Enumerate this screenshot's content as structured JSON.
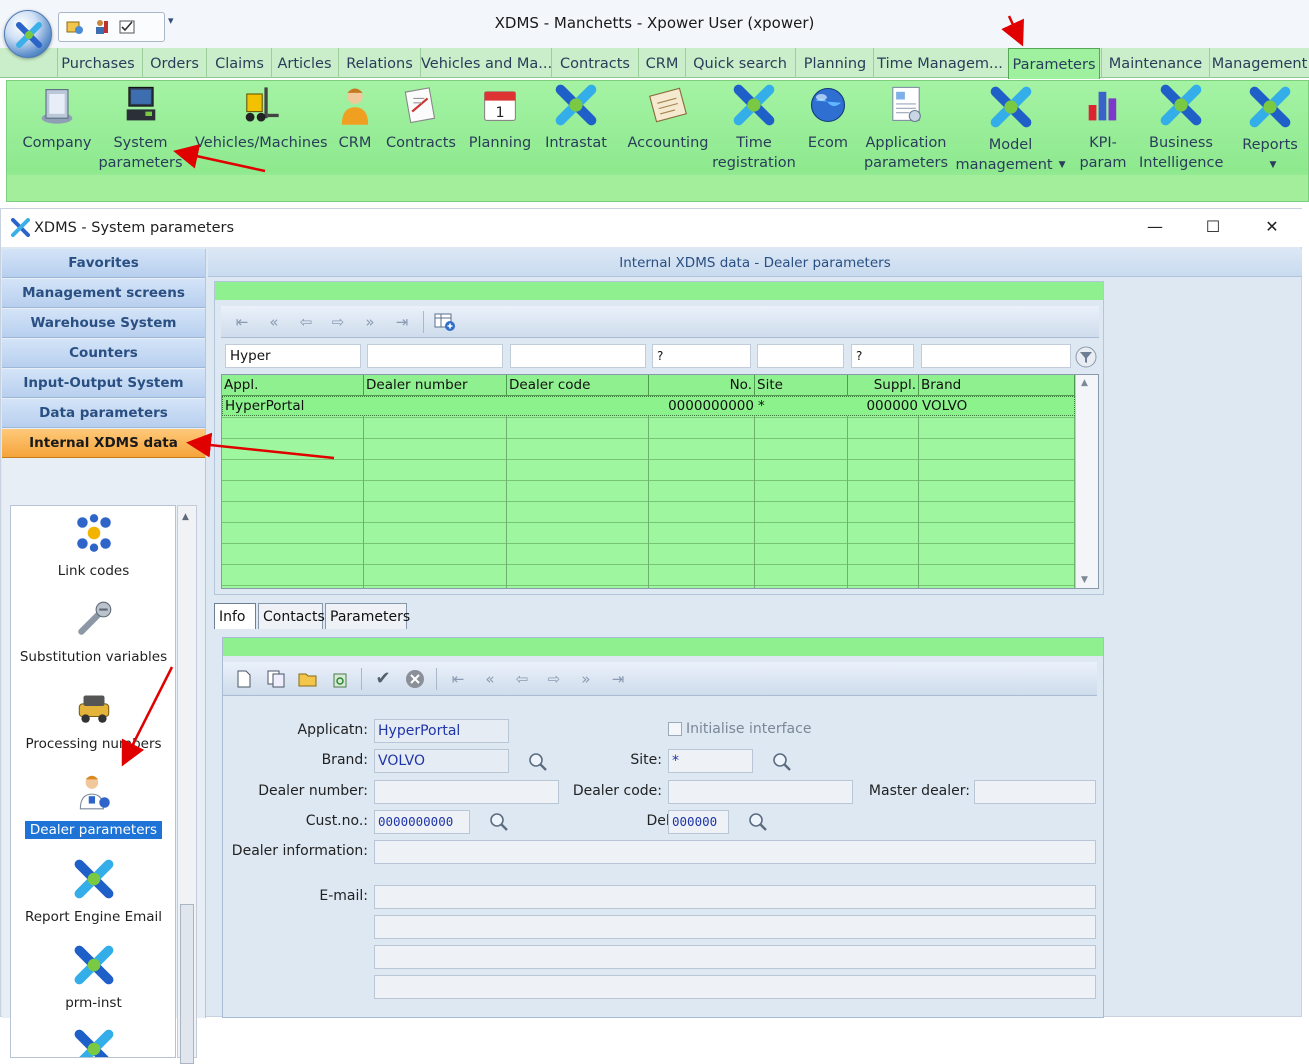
{
  "app": {
    "title": "XDMS - Manchetts - Xpower User (xpower)",
    "qat_more": "▾"
  },
  "ribbon": {
    "tabs": [
      "Purchases",
      "Orders",
      "Claims",
      "Articles",
      "Relations",
      "Vehicles and Ma...",
      "Contracts",
      "CRM",
      "Quick search",
      "Planning",
      "Time Managem...",
      "Parameters",
      "Maintenance",
      "Management"
    ],
    "active_tab": "Parameters",
    "buttons": [
      {
        "line1": "Company",
        "line2": "",
        "icon": "company-icon"
      },
      {
        "line1": "System",
        "line2": "parameters",
        "icon": "computer-icon"
      },
      {
        "line1": "Vehicles/Machines",
        "line2": "",
        "icon": "forklift-icon"
      },
      {
        "line1": "CRM",
        "line2": "",
        "icon": "person-icon"
      },
      {
        "line1": "Contracts",
        "line2": "",
        "icon": "contract-icon"
      },
      {
        "line1": "Planning",
        "line2": "",
        "icon": "calendar-icon"
      },
      {
        "line1": "Intrastat",
        "line2": "",
        "icon": "xdms-icon"
      },
      {
        "line1": "Accounting",
        "line2": "",
        "icon": "ledger-icon"
      },
      {
        "line1": "Time",
        "line2": "registration",
        "icon": "xdms-icon"
      },
      {
        "line1": "Ecom",
        "line2": "",
        "icon": "globe-icon"
      },
      {
        "line1": "Application",
        "line2": "parameters",
        "icon": "app-params-icon"
      },
      {
        "line1": "Model",
        "line2": "management",
        "icon": "xdms-icon",
        "dropdown": true
      },
      {
        "line1": "KPI-",
        "line2": "param",
        "icon": "bar-chart-icon"
      },
      {
        "line1": "Business",
        "line2": "Intelligence",
        "icon": "xdms-icon"
      },
      {
        "line1": "Reports",
        "line2": "",
        "icon": "xdms-icon",
        "dropdown": true
      }
    ]
  },
  "window": {
    "title": "XDMS - System parameters",
    "minimize": "—",
    "maximize": "☐",
    "close": "✕"
  },
  "nav": {
    "sections": [
      "Favorites",
      "Management screens",
      "Warehouse System",
      "Counters",
      "Input-Output System",
      "Data parameters",
      "Internal XDMS data"
    ],
    "selected_section": "Internal XDMS data",
    "items": [
      {
        "label": "Link codes",
        "icon": "link-codes-icon"
      },
      {
        "label": "Substitution variables",
        "icon": "screw-icon"
      },
      {
        "label": "Processing numbers",
        "icon": "processing-icon"
      },
      {
        "label": "Dealer parameters",
        "icon": "dealer-icon"
      },
      {
        "label": "Report Engine Email",
        "icon": "xdms-icon"
      },
      {
        "label": "prm-inst",
        "icon": "xdms-icon"
      }
    ],
    "selected_item": "Dealer parameters"
  },
  "main": {
    "header": "Internal XDMS data - Dealer parameters",
    "filters": [
      "Hyper",
      "",
      "",
      "?",
      "",
      "?",
      ""
    ],
    "columns": [
      "Appl.",
      "Dealer number",
      "Dealer code",
      "No.",
      "Site",
      "Suppl.",
      "Brand"
    ],
    "rows": [
      {
        "appl": "HyperPortal",
        "dealer_number": "",
        "dealer_code": "",
        "no": "0000000000",
        "site": "*",
        "suppl": "000000",
        "brand": "VOLVO"
      }
    ]
  },
  "detail": {
    "tabs": [
      "Info",
      "Contacts",
      "Parameters"
    ],
    "active_tab": "Info",
    "labels": {
      "applicatn": "Applicatn:",
      "brand": "Brand:",
      "site": "Site:",
      "dealer_number": "Dealer number:",
      "dealer_code": "Dealer code:",
      "master_dealer": "Master dealer:",
      "cust_no": "Cust.no.:",
      "deliv": "Deliv.:",
      "dealer_information": "Dealer information:",
      "email": "E-mail:",
      "initialise_interface": "Initialise interface"
    },
    "values": {
      "applicatn": "HyperPortal",
      "brand": "VOLVO",
      "site": "*",
      "dealer_number": "",
      "dealer_code": "",
      "master_dealer": "",
      "cust_no": "0000000000",
      "deliv": "000000",
      "dealer_information": "",
      "email_lines": [
        "",
        "",
        "",
        ""
      ],
      "initialise_interface": false
    }
  },
  "colors": {
    "ribbon_green": "#9ff19f",
    "grid_green": "#9ef79e",
    "nav_selected": "#f5a43a",
    "selection_blue": "#1e74d6",
    "annotation_red": "#e00000"
  }
}
